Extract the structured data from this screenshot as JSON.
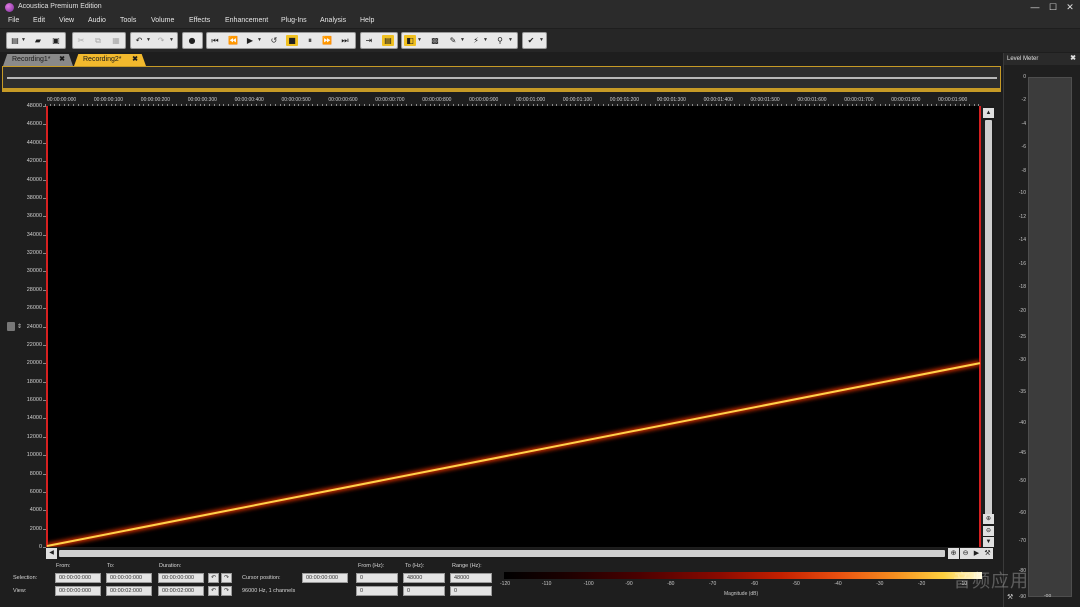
{
  "window": {
    "title": "Acoustica Premium Edition",
    "controls": [
      "—",
      "☐",
      "✕"
    ]
  },
  "menu": [
    "File",
    "Edit",
    "View",
    "Audio",
    "Tools",
    "Volume",
    "Effects",
    "Enhancement",
    "Plug-Ins",
    "Analysis",
    "Help"
  ],
  "tabs": [
    {
      "label": "Recording1*",
      "close": "✖",
      "active": false
    },
    {
      "label": "Recording2*",
      "close": "✖",
      "active": true
    }
  ],
  "ruler": {
    "labels": [
      "00:00:00:000",
      "00:00:00:100",
      "00:00:00:200",
      "00:00:00:300",
      "00:00:00:400",
      "00:00:00:500",
      "00:00:00:600",
      "00:00:00:700",
      "00:00:00:800",
      "00:00:00:900",
      "00:00:01:000",
      "00:00:01:100",
      "00:00:01:200",
      "00:00:01:300",
      "00:00:01:400",
      "00:00:01:500",
      "00:00:01:600",
      "00:00:01:700",
      "00:00:01:800",
      "00:00:01:900"
    ]
  },
  "frequency_axis": {
    "labels": [
      "48000",
      "46000",
      "44000",
      "42000",
      "40000",
      "38000",
      "36000",
      "34000",
      "32000",
      "30000",
      "28000",
      "26000",
      "24000",
      "22000",
      "20000",
      "18000",
      "16000",
      "14000",
      "12000",
      "10000",
      "8000",
      "6000",
      "4000",
      "2000",
      "0"
    ]
  },
  "spectrogram": {
    "sweep_start_hz": 0,
    "sweep_end_hz": 20000,
    "duration_s": 2.0,
    "line_color": "#ffd24a",
    "glow_color": "#e03000",
    "marker_color": "#d62020"
  },
  "level_meter": {
    "title": "Level Meter",
    "close": "✖",
    "ticks": [
      "0",
      "-2",
      "-4",
      "-6",
      "-8",
      "-10",
      "-12",
      "-14",
      "-16",
      "-18",
      "-20",
      "-25",
      "-30",
      "-35",
      "-40",
      "-45",
      "-50",
      "-60",
      "-70",
      "-80",
      "-90"
    ],
    "bottom_value": "-oo"
  },
  "status": {
    "from_label": "From:",
    "to_label": "To:",
    "duration_label": "Duration:",
    "selection_label": "Selection:",
    "view_label": "View:",
    "selection_from": "00:00:00:000",
    "selection_to": "00:00:00:000",
    "selection_duration": "00:00:00:000",
    "view_from": "00:00:00:000",
    "view_to": "00:00:02:000",
    "view_duration": "00:00:02:000",
    "cursor_label": "Cursor position:",
    "cursor_value": "00:00:00:000",
    "format_text": "96000 Hz, 1 channels",
    "from_hz_label": "From (Hz):",
    "to_hz_label": "To (Hz):",
    "range_hz_label": "Range (Hz):",
    "from_hz_sel": "0",
    "to_hz_sel": "48000",
    "range_hz_sel": "48000",
    "from_hz_view": "0",
    "to_hz_view": "0",
    "range_hz_view": "0",
    "undo": "↶",
    "redo": "↷"
  },
  "magnitude": {
    "label": "Magnitude (dB)",
    "ticks": [
      "-120",
      "-110",
      "-100",
      "-90",
      "-80",
      "-70",
      "-60",
      "-50",
      "-40",
      "-30",
      "-20",
      "-10"
    ]
  },
  "watermark": "音频应用"
}
